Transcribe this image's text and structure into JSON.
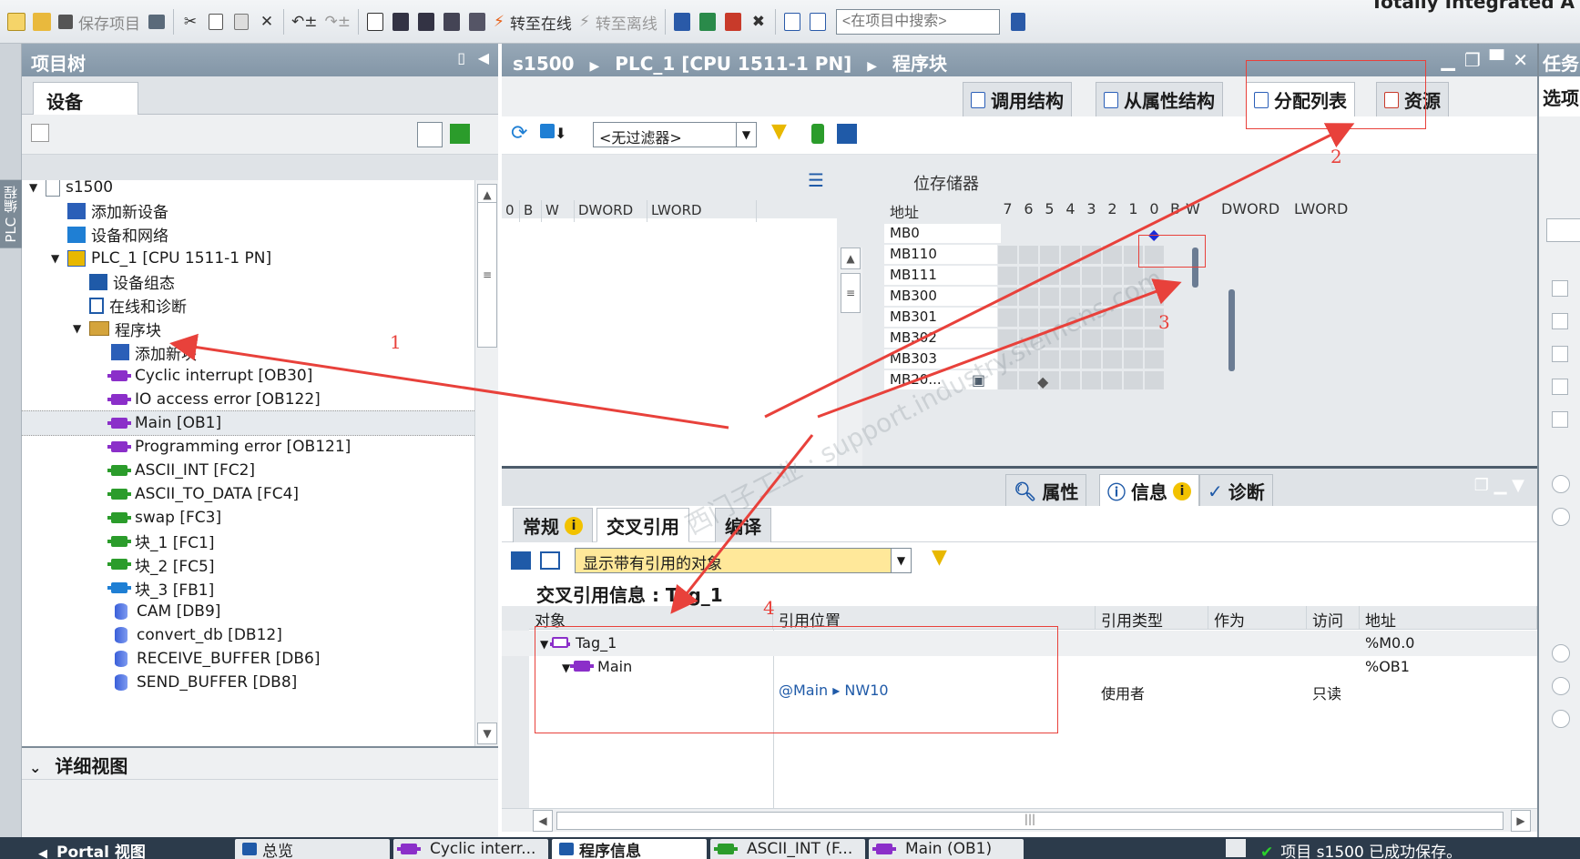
{
  "toolbar": {
    "save_project": "保存项目",
    "go_online": "转至在线",
    "go_offline": "转至离线",
    "search_placeholder": "<在项目中搜索>",
    "brand": "Totally Integrated A"
  },
  "sidestrip_label": "PLC 编程",
  "project_tree": {
    "title": "项目树",
    "tab": "设备",
    "items": [
      {
        "label": "s1500",
        "indent": 0,
        "expander": "▼",
        "icon": "doc"
      },
      {
        "label": "添加新设备",
        "indent": 1,
        "expander": "",
        "icon": "add-device"
      },
      {
        "label": "设备和网络",
        "indent": 1,
        "expander": "",
        "icon": "network"
      },
      {
        "label": "PLC_1 [CPU 1511-1 PN]",
        "indent": 1,
        "expander": "▼",
        "icon": "cpu"
      },
      {
        "label": "设备组态",
        "indent": 2,
        "expander": "",
        "icon": "config"
      },
      {
        "label": "在线和诊断",
        "indent": 2,
        "expander": "",
        "icon": "diag"
      },
      {
        "label": "程序块",
        "indent": 2,
        "expander": "▼",
        "icon": "folder"
      },
      {
        "label": "添加新块",
        "indent": 3,
        "expander": "",
        "icon": "add-block"
      },
      {
        "label": "Cyclic interrupt [OB30]",
        "indent": 3,
        "expander": "",
        "icon": "ob"
      },
      {
        "label": "IO access error [OB122]",
        "indent": 3,
        "expander": "",
        "icon": "ob"
      },
      {
        "label": "Main [OB1]",
        "indent": 3,
        "expander": "",
        "icon": "ob",
        "selected": true
      },
      {
        "label": "Programming error [OB121]",
        "indent": 3,
        "expander": "",
        "icon": "ob"
      },
      {
        "label": "ASCII_INT [FC2]",
        "indent": 3,
        "expander": "",
        "icon": "fc"
      },
      {
        "label": "ASCII_TO_DATA [FC4]",
        "indent": 3,
        "expander": "",
        "icon": "fc"
      },
      {
        "label": "swap [FC3]",
        "indent": 3,
        "expander": "",
        "icon": "fc"
      },
      {
        "label": "块_1 [FC1]",
        "indent": 3,
        "expander": "",
        "icon": "fc"
      },
      {
        "label": "块_2 [FC5]",
        "indent": 3,
        "expander": "",
        "icon": "fc"
      },
      {
        "label": "块_3 [FB1]",
        "indent": 3,
        "expander": "",
        "icon": "fb"
      },
      {
        "label": "CAM [DB9]",
        "indent": 3,
        "expander": "",
        "icon": "db"
      },
      {
        "label": "convert_db [DB12]",
        "indent": 3,
        "expander": "",
        "icon": "db"
      },
      {
        "label": "RECEIVE_BUFFER [DB6]",
        "indent": 3,
        "expander": "",
        "icon": "db"
      },
      {
        "label": "SEND_BUFFER [DB8]",
        "indent": 3,
        "expander": "",
        "icon": "db"
      }
    ]
  },
  "detail_view": {
    "title": "详细视图"
  },
  "editor": {
    "breadcrumb": [
      "s1500",
      "PLC_1 [CPU 1511-1 PN]",
      "程序块"
    ],
    "tabs": [
      "调用结构",
      "从属性结构",
      "分配列表",
      "资源"
    ],
    "active_tab": "分配列表",
    "filter_value": "<无过滤器>",
    "mem_title": "位存储器",
    "left_cols": [
      "0",
      "B",
      "W",
      "DWORD",
      "LWORD"
    ],
    "addr_header": "地址",
    "bit_cols": [
      "7",
      "6",
      "5",
      "4",
      "3",
      "2",
      "1",
      "0",
      "B",
      "W",
      "DWORD",
      "LWORD"
    ],
    "rows": [
      "MB0",
      "MB110",
      "MB111",
      "MB300",
      "MB301",
      "MB302",
      "MB303",
      "MB20..."
    ]
  },
  "inspector": {
    "tabs": [
      "属性",
      "信息",
      "诊断"
    ],
    "active_tab": "信息",
    "sub_tabs": [
      "常规",
      "交叉引用",
      "编译"
    ],
    "active_sub_tab": "交叉引用",
    "filter_value": "显示带有引用的对象",
    "xref_title": "交叉引用信息 : Tag_1",
    "columns": [
      "对象",
      "引用位置",
      "引用类型",
      "作为",
      "访问",
      "地址"
    ],
    "rows": [
      {
        "object": "Tag_1",
        "location": "",
        "type": "",
        "as": "",
        "access": "",
        "address": "%M0.0"
      },
      {
        "object": "Main",
        "location": "",
        "type": "",
        "as": "",
        "access": "",
        "address": "%OB1"
      },
      {
        "object": "",
        "location": "@Main ▸ NW10",
        "type": "使用者",
        "as": "",
        "access": "只读",
        "address": ""
      }
    ]
  },
  "tasks": {
    "title": "任务",
    "options": "选项"
  },
  "statusbar": {
    "portal": "Portal 视图",
    "tabs": [
      "总览",
      "Cyclic interr...",
      "程序信息",
      "ASCII_INT (F...",
      "Main (OB1)"
    ],
    "active_tab": "程序信息",
    "message": "项目 s1500 已成功保存。"
  },
  "annotations": [
    "1",
    "2",
    "3",
    "4"
  ],
  "colors": {
    "annotation": "#e8413b",
    "header": "#8b9cad",
    "marker": "#1a2bd6"
  }
}
